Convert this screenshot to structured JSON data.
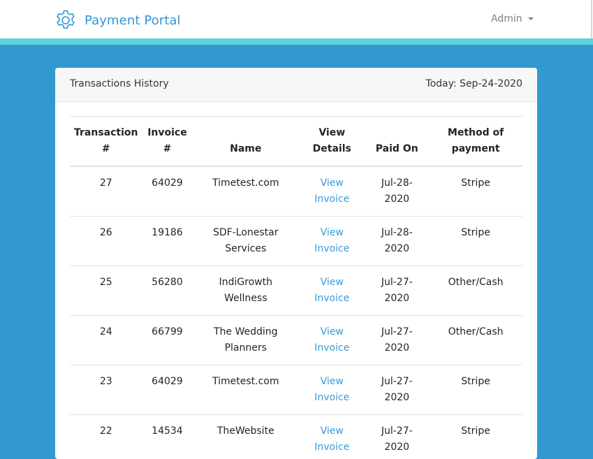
{
  "navbar": {
    "brand": "Payment Portal",
    "brand_icon": "gear-icon",
    "user_menu": "Admin"
  },
  "colors": {
    "brand": "#2f97d6",
    "background": "#3498d0",
    "accent_strip": "#5ed3dc",
    "link": "#3a9ad9"
  },
  "card": {
    "title": "Transactions History",
    "today": "Today: Sep-24-2020"
  },
  "table": {
    "headers": {
      "transaction_line1": "Transaction",
      "transaction_line2": "#",
      "invoice_line1": "Invoice",
      "invoice_line2": "#",
      "name": "Name",
      "view_line1": "View",
      "view_line2": "Details",
      "paid_on": "Paid On",
      "method_line1": "Method of",
      "method_line2": "payment"
    },
    "rows": [
      {
        "transaction": "27",
        "invoice": "64029",
        "name_line1": "Timetest.com",
        "name_line2": "",
        "view_line1": "View",
        "view_line2": "Invoice",
        "paid_line1": "Jul-28-",
        "paid_line2": "2020",
        "method": "Stripe"
      },
      {
        "transaction": "26",
        "invoice": "19186",
        "name_line1": "SDF-Lonestar",
        "name_line2": "Services",
        "view_line1": "View",
        "view_line2": "Invoice",
        "paid_line1": "Jul-28-",
        "paid_line2": "2020",
        "method": "Stripe"
      },
      {
        "transaction": "25",
        "invoice": "56280",
        "name_line1": "IndiGrowth",
        "name_line2": "Wellness",
        "view_line1": "View",
        "view_line2": "Invoice",
        "paid_line1": "Jul-27-",
        "paid_line2": "2020",
        "method": "Other/Cash"
      },
      {
        "transaction": "24",
        "invoice": "66799",
        "name_line1": "The Wedding",
        "name_line2": "Planners",
        "view_line1": "View",
        "view_line2": "Invoice",
        "paid_line1": "Jul-27-",
        "paid_line2": "2020",
        "method": "Other/Cash"
      },
      {
        "transaction": "23",
        "invoice": "64029",
        "name_line1": "Timetest.com",
        "name_line2": "",
        "view_line1": "View",
        "view_line2": "Invoice",
        "paid_line1": "Jul-27-",
        "paid_line2": "2020",
        "method": "Stripe"
      },
      {
        "transaction": "22",
        "invoice": "14534",
        "name_line1": "TheWebsite",
        "name_line2": "",
        "view_line1": "View",
        "view_line2": "Invoice",
        "paid_line1": "Jul-27-",
        "paid_line2": "2020",
        "method": "Stripe"
      }
    ]
  }
}
